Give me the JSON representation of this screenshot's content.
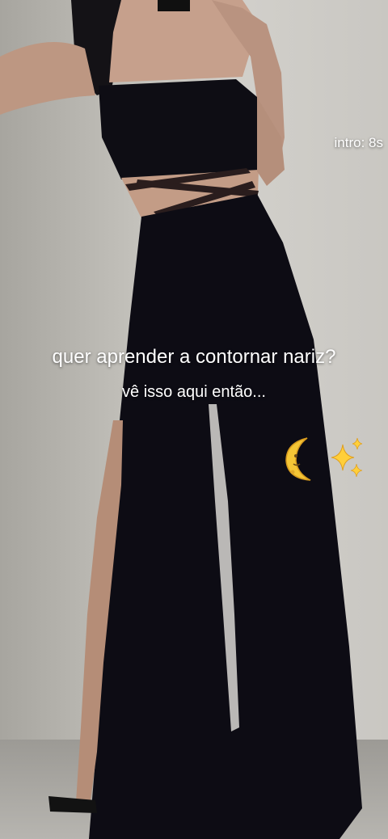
{
  "overlay": {
    "intro_label": "intro: 8s",
    "headline": "quer aprender a contornar nariz?",
    "subline": "vê isso aqui então..."
  },
  "decorations": {
    "moon_icon": "crescent-moon-face",
    "sparkles_icon": "sparkles"
  },
  "colors": {
    "text": "#ffffff",
    "outfit": "#0d0c14",
    "wall": "#c8c6c1",
    "moon": "#f5c636",
    "sparkle": "#ffcf3a"
  }
}
